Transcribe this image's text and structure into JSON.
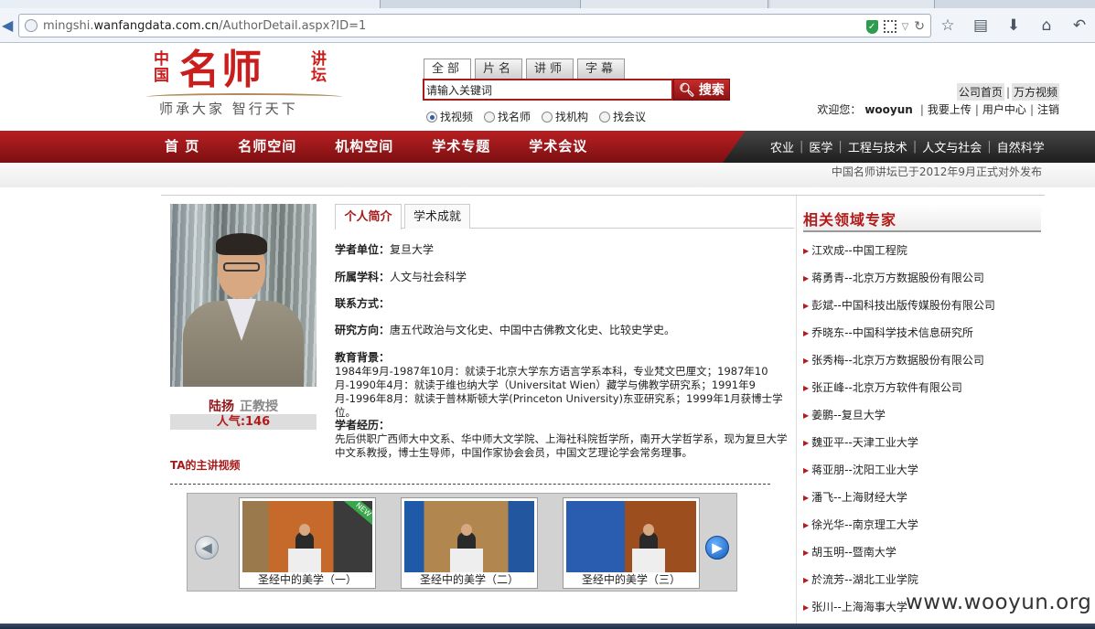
{
  "browser": {
    "url_plain_prefix": "mingshi.",
    "url_domain": "wanfangdata.com.cn",
    "url_path": "/AuthorDetail.aspx?ID=1"
  },
  "logo": {
    "left_chars": "中国",
    "main": "名师",
    "right_chars": "讲坛",
    "slogan": "师承大家  智行天下"
  },
  "search": {
    "tabs": [
      "全部",
      "片名",
      "讲师",
      "字幕"
    ],
    "input_value": "请输入关键词",
    "button_label": "搜索",
    "radios": [
      {
        "label": "找视频",
        "checked": true
      },
      {
        "label": "找名师",
        "checked": false
      },
      {
        "label": "找机构",
        "checked": false
      },
      {
        "label": "找会议",
        "checked": false
      }
    ]
  },
  "toplinks": {
    "home": "公司首页",
    "video": "万方视频",
    "welcome": "欢迎您：",
    "user": "wooyun",
    "upload": "我要上传",
    "usercenter": "用户中心",
    "logout": "注销"
  },
  "mainnav": [
    "首 页",
    "名师空间",
    "机构空间",
    "学术专题",
    "学术会议"
  ],
  "subnav": [
    "农业",
    "医学",
    "工程与技术",
    "人文与社会",
    "自然科学"
  ],
  "notice": "中国名师讲坛已于2012年9月正式对外发布",
  "profile": {
    "name": "陆扬",
    "title": "正教授",
    "popularity": "人气:146",
    "ta_videos": "TA的主讲视频"
  },
  "tabs": {
    "intro": "个人简介",
    "achievements": "学术成就"
  },
  "info": {
    "unit_label": "学者单位：",
    "unit": "复旦大学",
    "subject_label": "所属学科：",
    "subject": "人文与社会科学",
    "contact_label": "联系方式：",
    "direction_label": "研究方向：",
    "direction": "唐五代政治与文化史、中国中古佛教文化史、比较史学史。",
    "edu_label": "教育背景：",
    "edu": "1984年9月-1987年10月：就读于北京大学东方语言学系本科，专业梵文巴厘文；1987年10月-1990年4月：就读于维也纳大学（Universitat Wien）藏学与佛教学研究系；1991年9月-1996年8月：就读于普林斯顿大学(Princeton University)东亚研究系；1999年1月获博士学位。",
    "exp_label": "学者经历：",
    "exp": "先后供职广西师大中文系、华中师大文学院、上海社科院哲学所，南开大学哲学系，现为复旦大学中文系教授，博士生导师，中国作家协会会员，中国文艺理论学会常务理事。"
  },
  "videos": [
    {
      "caption": "圣经中的美学（一）"
    },
    {
      "caption": "圣经中的美学（二）"
    },
    {
      "caption": "圣经中的美学（三）"
    }
  ],
  "sidebar": {
    "title": "相关领域专家",
    "experts": [
      "江欢成--中国工程院",
      "蒋勇青--北京万方数据股份有限公司",
      "彭斌--中国科技出版传媒股份有限公司",
      "乔晓东--中国科学技术信息研究所",
      "张秀梅--北京万方数据股份有限公司",
      "张正峰--北京万方软件有限公司",
      "姜鹏--复旦大学",
      "魏亚平--天津工业大学",
      "蒋亚朋--沈阳工业大学",
      "潘飞--上海财经大学",
      "徐光华--南京理工大学",
      "胡玉明--暨南大学",
      "於流芳--湖北工业学院",
      "张川--上海海事大学"
    ]
  },
  "watermark": "www.wooyun.org"
}
